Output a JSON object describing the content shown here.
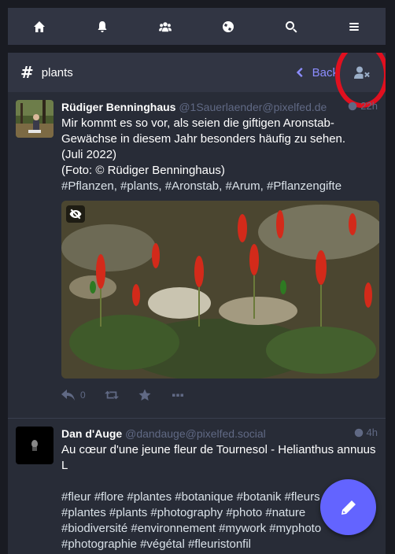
{
  "colors": {
    "accent": "#6364ff",
    "link": "#8c8dff",
    "annotation": "#e0101f"
  },
  "nav": {
    "items": [
      {
        "name": "home",
        "icon": "home-icon"
      },
      {
        "name": "notifications",
        "icon": "bell-icon"
      },
      {
        "name": "local",
        "icon": "users-icon"
      },
      {
        "name": "federated",
        "icon": "globe-icon"
      },
      {
        "name": "search",
        "icon": "search-icon"
      },
      {
        "name": "menu",
        "icon": "bars-icon"
      }
    ]
  },
  "column": {
    "title": "plants",
    "back_label": "Back"
  },
  "statuses": [
    {
      "display_name": "Rüdiger Benninghaus",
      "acct": "@1Sauerlaender@pixelfed.de",
      "time": "22h",
      "lines": [
        "Mir kommt es so vor, als seien die giftigen Aronstab-Gewächse in diesem Jahr besonders häufig zu sehen.",
        "(Juli 2022)",
        "(Foto: © Rüdiger Benninghaus)",
        "#Pflanzen, #plants, #Aronstab, #Arum, #Pflanzengifte"
      ],
      "reply_count": "0"
    },
    {
      "display_name": "Dan d'Auge",
      "acct": "@dandauge@pixelfed.social",
      "time": "4h",
      "lines": [
        "Au cœur d'une jeune fleur de Tournesol - Helianthus annuus L",
        "#fleur #flore #plantes #botanique #botanik #fleurs #flower",
        "#plantes #plants #photography #photo #nature",
        "#biodiversité #environnement #mywork #myphoto",
        "#photographie #végétal #fleuristonfil"
      ]
    }
  ]
}
